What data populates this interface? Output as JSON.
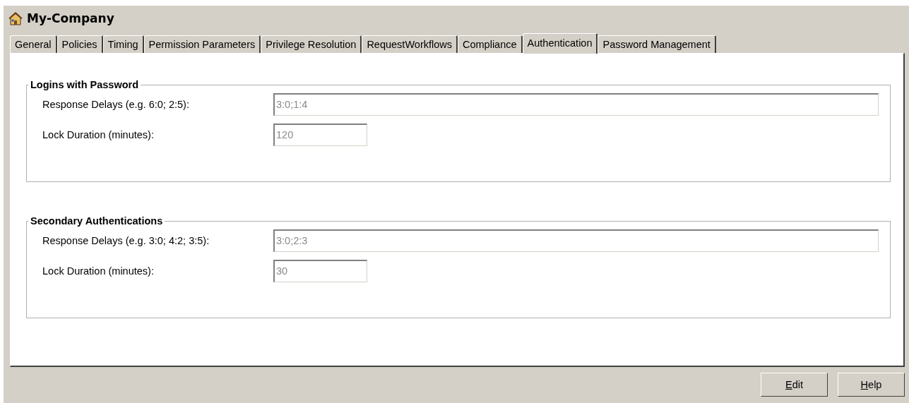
{
  "window": {
    "title": "My-Company"
  },
  "tabs": [
    {
      "label": "General",
      "selected": false
    },
    {
      "label": "Policies",
      "selected": false
    },
    {
      "label": "Timing",
      "selected": false
    },
    {
      "label": "Permission Parameters",
      "selected": false
    },
    {
      "label": "Privilege Resolution",
      "selected": false
    },
    {
      "label": "RequestWorkflows",
      "selected": false
    },
    {
      "label": "Compliance",
      "selected": false
    },
    {
      "label": "Authentication",
      "selected": true
    },
    {
      "label": "Password Management",
      "selected": false
    }
  ],
  "groups": [
    {
      "title": "Logins with Password",
      "fields": [
        {
          "label": "Response Delays (e.g. 6:0; 2:5):",
          "value": "3:0;1:4",
          "kind": "wide",
          "disabled": true
        },
        {
          "label": "Lock Duration (minutes):",
          "value": "120",
          "kind": "short",
          "disabled": true
        }
      ]
    },
    {
      "title": "Secondary Authentications",
      "fields": [
        {
          "label": "Response Delays (e.g. 3:0; 4:2; 3:5):",
          "value": "3:0;2:3",
          "kind": "wide",
          "disabled": true
        },
        {
          "label": "Lock Duration (minutes):",
          "value": "30",
          "kind": "short",
          "disabled": true
        }
      ]
    }
  ],
  "buttons": [
    {
      "label": "Edit"
    },
    {
      "label": "Help"
    }
  ]
}
